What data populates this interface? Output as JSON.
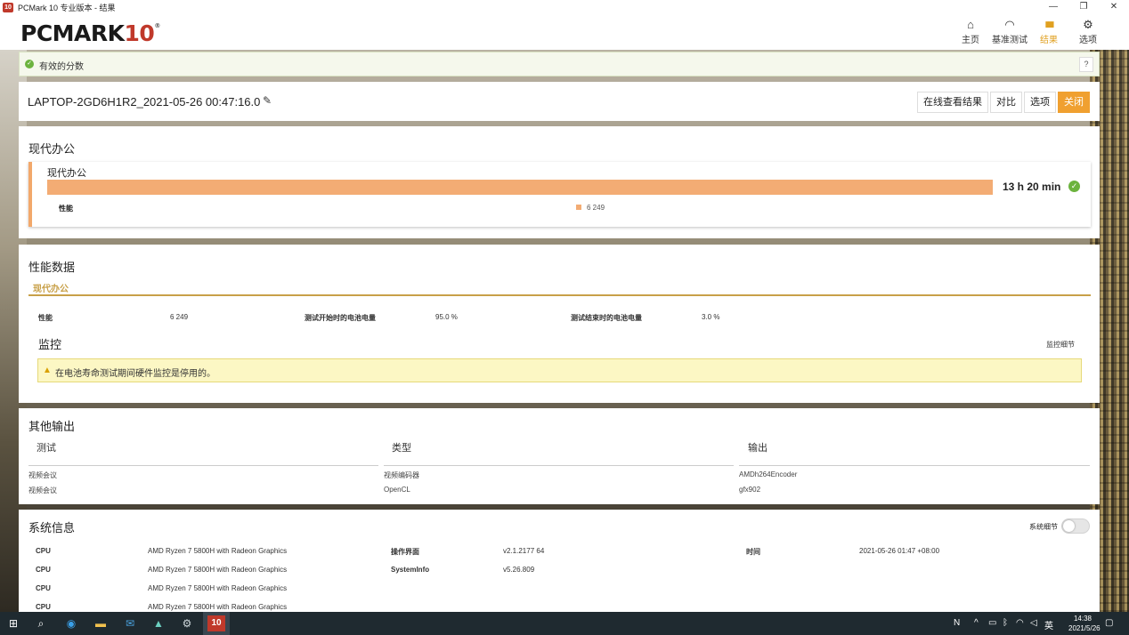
{
  "window": {
    "title": "PCMark 10 专业版本 - 结果",
    "app_icon": "10",
    "controls": [
      "—",
      "❐",
      "✕"
    ]
  },
  "header": {
    "logo_main": "PCMARK",
    "logo_ten": "10",
    "logo_reg": "®",
    "nav": [
      {
        "icon": "home-icon",
        "glyph": "⌂",
        "label": "主页"
      },
      {
        "icon": "benchmark-icon",
        "glyph": "◠",
        "label": "基准测试"
      },
      {
        "icon": "results-icon",
        "glyph": "▮▮▮",
        "label": "结果",
        "active": true
      },
      {
        "icon": "gear-icon",
        "glyph": "⚙",
        "label": "选项"
      }
    ]
  },
  "valid_score": {
    "text": "有效的分数",
    "help": "?"
  },
  "result": {
    "title": "LAPTOP-2GD6H1R2_2021-05-26 00:47:16.0",
    "buttons": {
      "view_online": "在线查看结果",
      "compare": "对比",
      "options": "选项",
      "close": "关闭"
    }
  },
  "modern_office": {
    "section_title": "现代办公",
    "card_title": "现代办公",
    "duration": "13 h 20 min",
    "perf_label": "性能",
    "perf_value": "6 249",
    "colors": {
      "bar": "#f3ac74",
      "check": "#6cb33e"
    }
  },
  "perf_data": {
    "section_title": "性能数据",
    "tab": "现代办公",
    "items": [
      {
        "label": "性能",
        "value": "6 249"
      },
      {
        "label": "测试开始时的电池电量",
        "value": "95.0 %"
      },
      {
        "label": "测试结束时的电池电量",
        "value": "3.0 %"
      }
    ],
    "monitor_title": "监控",
    "monitor_link": "监控细节",
    "warning": "在电池寿命测试期间硬件监控是停用的。"
  },
  "other_output": {
    "section_title": "其他输出",
    "headers": [
      "测试",
      "类型",
      "输出"
    ],
    "rows": [
      [
        "视频会议",
        "视频编码器",
        "AMDh264Encoder"
      ],
      [
        "视频会议",
        "OpenCL",
        "gfx902"
      ]
    ]
  },
  "system_info": {
    "section_title": "系统信息",
    "toggle_label": "系统细节",
    "cpu_rows": [
      {
        "label": "CPU",
        "value": "AMD Ryzen 7 5800H with Radeon Graphics"
      },
      {
        "label": "CPU",
        "value": "AMD Ryzen 7 5800H with Radeon Graphics"
      },
      {
        "label": "CPU",
        "value": "AMD Ryzen 7 5800H with Radeon Graphics"
      },
      {
        "label": "CPU",
        "value": "AMD Ryzen 7 5800H with Radeon Graphics"
      }
    ],
    "mid_rows": [
      {
        "label": "操作界面",
        "value": "v2.1.2177 64"
      },
      {
        "label": "SystemInfo",
        "value": "v5.26.809"
      }
    ],
    "time_label": "时间",
    "time_value": "2021-05-26 01:47 +08:00"
  },
  "taskbar": {
    "active_app": "10",
    "tray_ime": "英",
    "time": "14:38",
    "date": "2021/5/26"
  }
}
